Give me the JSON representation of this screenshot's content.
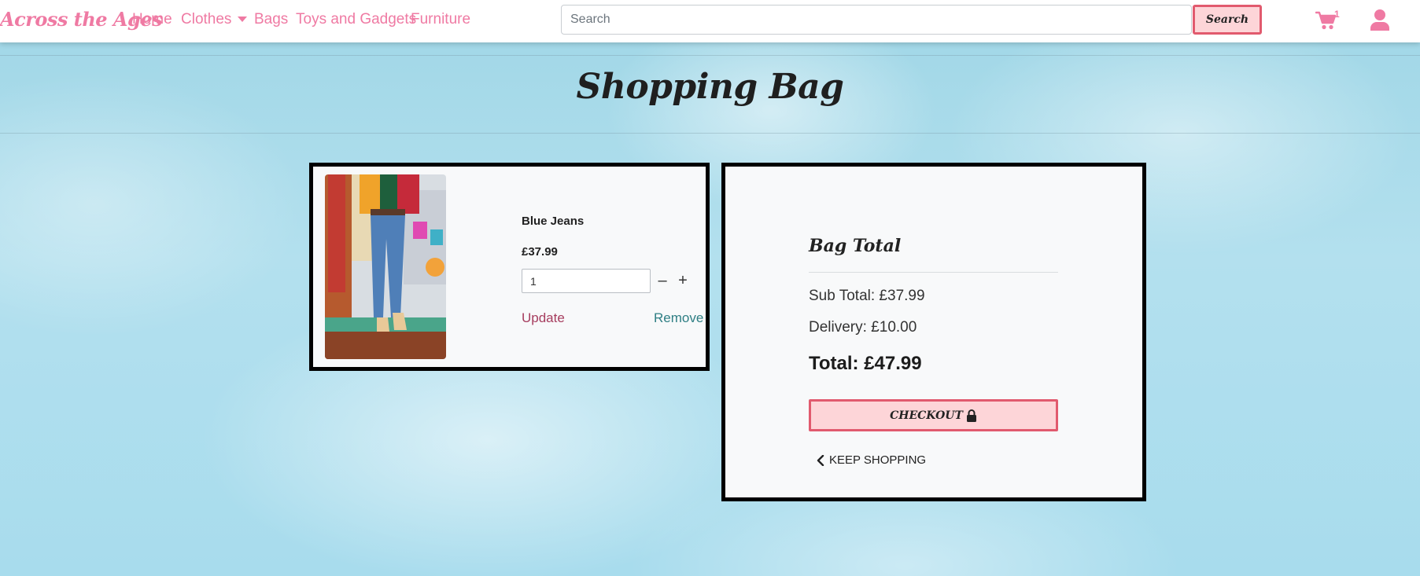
{
  "nav": {
    "brand": "Across the Ages",
    "links": {
      "home": "Home",
      "clothes": "Clothes",
      "bags": "Bags",
      "toys": "Toys and Gadgets",
      "furniture": "Furniture"
    },
    "search": {
      "placeholder": "Search",
      "button_label": "Search"
    },
    "cart_count": "1",
    "icons": {
      "cart": "shopping-cart-icon",
      "user": "user-icon",
      "clothes_dropdown": "caret-down-icon"
    },
    "accent_color": "#ef7aa3"
  },
  "page": {
    "title": "Shopping Bag"
  },
  "bag_items": [
    {
      "name": "Blue Jeans",
      "price": "£37.99",
      "quantity": "1",
      "decrement_symbol": "–",
      "increment_symbol": "+",
      "update_label": "Update",
      "remove_label": "Remove"
    }
  ],
  "summary": {
    "heading": "Bag Total",
    "subtotal": "Sub Total: £37.99",
    "delivery": "Delivery: £10.00",
    "total": "Total: £47.99",
    "checkout_label": "CHECKOUT",
    "checkout_icon": "lock-icon",
    "keep_shopping_label": "KEEP SHOPPING",
    "keep_shopping_icon": "chevron-left-icon"
  },
  "colors": {
    "button_bg": "#fdd5d8",
    "button_border": "#e15a6e",
    "update_link": "#a63d5e",
    "remove_link": "#2f7f84"
  }
}
